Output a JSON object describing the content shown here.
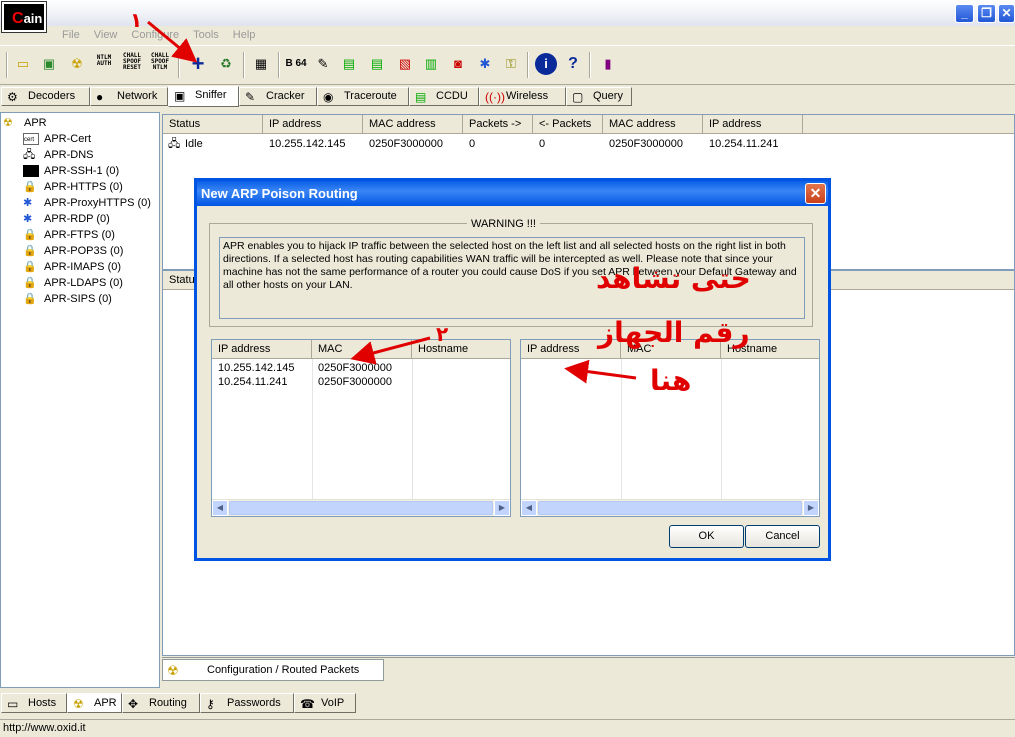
{
  "app": {
    "logo_text": "ain",
    "url": "http://www.oxid.it"
  },
  "menu": [
    "File",
    "View",
    "Configure",
    "Tools",
    "Help"
  ],
  "toolbar": {
    "ntlm": "NTLM AUTH",
    "chall1": "CHALL SPOOF RESET",
    "chall2": "CHALL SPOOF NTLM",
    "b64": "B 64"
  },
  "tabs": [
    "Decoders",
    "Network",
    "Sniffer",
    "Cracker",
    "Traceroute",
    "CCDU",
    "Wireless",
    "Query"
  ],
  "tree": {
    "root": "APR",
    "items": [
      "APR-Cert",
      "APR-DNS",
      "APR-SSH-1 (0)",
      "APR-HTTPS (0)",
      "APR-ProxyHTTPS (0)",
      "APR-RDP (0)",
      "APR-FTPS (0)",
      "APR-POP3S (0)",
      "APR-IMAPS (0)",
      "APR-LDAPS (0)",
      "APR-SIPS (0)"
    ]
  },
  "main_table": {
    "headers": [
      "Status",
      "IP address",
      "MAC address",
      "Packets ->",
      "<- Packets",
      "MAC address",
      "IP address"
    ],
    "rows": [
      [
        "Idle",
        "10.255.142.145",
        "0250F3000000",
        "0",
        "0",
        "0250F3000000",
        "10.254.11.241"
      ]
    ]
  },
  "lower_header": "Status",
  "dialog": {
    "title": "New ARP Poison Routing",
    "warning_title": "WARNING !!!",
    "warning_text": "APR enables you to hijack IP traffic between the selected host on the left list and all selected hosts on the right list in both directions. If a selected host has routing capabilities WAN traffic will be intercepted as well. Please note that since your machine has not the same performance of a router you could cause DoS if you set APR between your Default Gateway and all other hosts on your LAN.",
    "left_headers": [
      "IP address",
      "MAC",
      "Hostname"
    ],
    "left_rows": [
      [
        "10.255.142.145",
        "0250F3000000",
        ""
      ],
      [
        "10.254.11.241",
        "0250F3000000",
        ""
      ]
    ],
    "right_headers": [
      "IP address",
      "MAC",
      "Hostname"
    ],
    "ok": "OK",
    "cancel": "Cancel"
  },
  "annotations": {
    "num1": "١",
    "num2": "٢",
    "line1": "حتى تشاهد",
    "line2": "رقم الجهاز",
    "line3": "هنا"
  },
  "bottom": {
    "config_tab": "Configuration / Routed Packets",
    "tabs": [
      "Hosts",
      "APR",
      "Routing",
      "Passwords",
      "VoIP"
    ]
  }
}
